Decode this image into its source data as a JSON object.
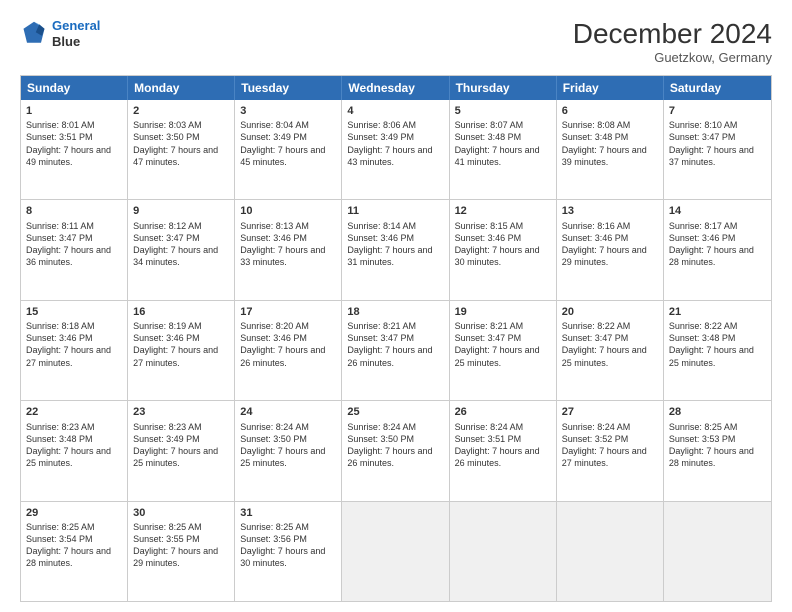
{
  "header": {
    "logo_line1": "General",
    "logo_line2": "Blue",
    "month_title": "December 2024",
    "location": "Guetzkow, Germany"
  },
  "weekdays": [
    "Sunday",
    "Monday",
    "Tuesday",
    "Wednesday",
    "Thursday",
    "Friday",
    "Saturday"
  ],
  "rows": [
    [
      {
        "day": "1",
        "sunrise": "Sunrise: 8:01 AM",
        "sunset": "Sunset: 3:51 PM",
        "daylight": "Daylight: 7 hours and 49 minutes."
      },
      {
        "day": "2",
        "sunrise": "Sunrise: 8:03 AM",
        "sunset": "Sunset: 3:50 PM",
        "daylight": "Daylight: 7 hours and 47 minutes."
      },
      {
        "day": "3",
        "sunrise": "Sunrise: 8:04 AM",
        "sunset": "Sunset: 3:49 PM",
        "daylight": "Daylight: 7 hours and 45 minutes."
      },
      {
        "day": "4",
        "sunrise": "Sunrise: 8:06 AM",
        "sunset": "Sunset: 3:49 PM",
        "daylight": "Daylight: 7 hours and 43 minutes."
      },
      {
        "day": "5",
        "sunrise": "Sunrise: 8:07 AM",
        "sunset": "Sunset: 3:48 PM",
        "daylight": "Daylight: 7 hours and 41 minutes."
      },
      {
        "day": "6",
        "sunrise": "Sunrise: 8:08 AM",
        "sunset": "Sunset: 3:48 PM",
        "daylight": "Daylight: 7 hours and 39 minutes."
      },
      {
        "day": "7",
        "sunrise": "Sunrise: 8:10 AM",
        "sunset": "Sunset: 3:47 PM",
        "daylight": "Daylight: 7 hours and 37 minutes."
      }
    ],
    [
      {
        "day": "8",
        "sunrise": "Sunrise: 8:11 AM",
        "sunset": "Sunset: 3:47 PM",
        "daylight": "Daylight: 7 hours and 36 minutes."
      },
      {
        "day": "9",
        "sunrise": "Sunrise: 8:12 AM",
        "sunset": "Sunset: 3:47 PM",
        "daylight": "Daylight: 7 hours and 34 minutes."
      },
      {
        "day": "10",
        "sunrise": "Sunrise: 8:13 AM",
        "sunset": "Sunset: 3:46 PM",
        "daylight": "Daylight: 7 hours and 33 minutes."
      },
      {
        "day": "11",
        "sunrise": "Sunrise: 8:14 AM",
        "sunset": "Sunset: 3:46 PM",
        "daylight": "Daylight: 7 hours and 31 minutes."
      },
      {
        "day": "12",
        "sunrise": "Sunrise: 8:15 AM",
        "sunset": "Sunset: 3:46 PM",
        "daylight": "Daylight: 7 hours and 30 minutes."
      },
      {
        "day": "13",
        "sunrise": "Sunrise: 8:16 AM",
        "sunset": "Sunset: 3:46 PM",
        "daylight": "Daylight: 7 hours and 29 minutes."
      },
      {
        "day": "14",
        "sunrise": "Sunrise: 8:17 AM",
        "sunset": "Sunset: 3:46 PM",
        "daylight": "Daylight: 7 hours and 28 minutes."
      }
    ],
    [
      {
        "day": "15",
        "sunrise": "Sunrise: 8:18 AM",
        "sunset": "Sunset: 3:46 PM",
        "daylight": "Daylight: 7 hours and 27 minutes."
      },
      {
        "day": "16",
        "sunrise": "Sunrise: 8:19 AM",
        "sunset": "Sunset: 3:46 PM",
        "daylight": "Daylight: 7 hours and 27 minutes."
      },
      {
        "day": "17",
        "sunrise": "Sunrise: 8:20 AM",
        "sunset": "Sunset: 3:46 PM",
        "daylight": "Daylight: 7 hours and 26 minutes."
      },
      {
        "day": "18",
        "sunrise": "Sunrise: 8:21 AM",
        "sunset": "Sunset: 3:47 PM",
        "daylight": "Daylight: 7 hours and 26 minutes."
      },
      {
        "day": "19",
        "sunrise": "Sunrise: 8:21 AM",
        "sunset": "Sunset: 3:47 PM",
        "daylight": "Daylight: 7 hours and 25 minutes."
      },
      {
        "day": "20",
        "sunrise": "Sunrise: 8:22 AM",
        "sunset": "Sunset: 3:47 PM",
        "daylight": "Daylight: 7 hours and 25 minutes."
      },
      {
        "day": "21",
        "sunrise": "Sunrise: 8:22 AM",
        "sunset": "Sunset: 3:48 PM",
        "daylight": "Daylight: 7 hours and 25 minutes."
      }
    ],
    [
      {
        "day": "22",
        "sunrise": "Sunrise: 8:23 AM",
        "sunset": "Sunset: 3:48 PM",
        "daylight": "Daylight: 7 hours and 25 minutes."
      },
      {
        "day": "23",
        "sunrise": "Sunrise: 8:23 AM",
        "sunset": "Sunset: 3:49 PM",
        "daylight": "Daylight: 7 hours and 25 minutes."
      },
      {
        "day": "24",
        "sunrise": "Sunrise: 8:24 AM",
        "sunset": "Sunset: 3:50 PM",
        "daylight": "Daylight: 7 hours and 25 minutes."
      },
      {
        "day": "25",
        "sunrise": "Sunrise: 8:24 AM",
        "sunset": "Sunset: 3:50 PM",
        "daylight": "Daylight: 7 hours and 26 minutes."
      },
      {
        "day": "26",
        "sunrise": "Sunrise: 8:24 AM",
        "sunset": "Sunset: 3:51 PM",
        "daylight": "Daylight: 7 hours and 26 minutes."
      },
      {
        "day": "27",
        "sunrise": "Sunrise: 8:24 AM",
        "sunset": "Sunset: 3:52 PM",
        "daylight": "Daylight: 7 hours and 27 minutes."
      },
      {
        "day": "28",
        "sunrise": "Sunrise: 8:25 AM",
        "sunset": "Sunset: 3:53 PM",
        "daylight": "Daylight: 7 hours and 28 minutes."
      }
    ],
    [
      {
        "day": "29",
        "sunrise": "Sunrise: 8:25 AM",
        "sunset": "Sunset: 3:54 PM",
        "daylight": "Daylight: 7 hours and 28 minutes."
      },
      {
        "day": "30",
        "sunrise": "Sunrise: 8:25 AM",
        "sunset": "Sunset: 3:55 PM",
        "daylight": "Daylight: 7 hours and 29 minutes."
      },
      {
        "day": "31",
        "sunrise": "Sunrise: 8:25 AM",
        "sunset": "Sunset: 3:56 PM",
        "daylight": "Daylight: 7 hours and 30 minutes."
      },
      {
        "day": "",
        "sunrise": "",
        "sunset": "",
        "daylight": ""
      },
      {
        "day": "",
        "sunrise": "",
        "sunset": "",
        "daylight": ""
      },
      {
        "day": "",
        "sunrise": "",
        "sunset": "",
        "daylight": ""
      },
      {
        "day": "",
        "sunrise": "",
        "sunset": "",
        "daylight": ""
      }
    ]
  ]
}
